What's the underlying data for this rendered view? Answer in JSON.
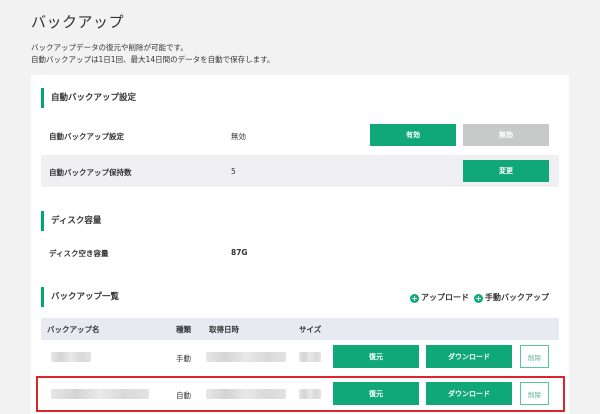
{
  "page": {
    "title": "バックアップ",
    "description_line1": "バックアップデータの復元や削除が可能です。",
    "description_line2": "自動バックアップは1日1回、最大14日間のデータを自動で保存します。"
  },
  "auto_backup": {
    "section_title": "自動バックアップ設定",
    "setting_label": "自動バックアップ設定",
    "setting_value": "無効",
    "enable_button": "有効",
    "disable_button": "無効",
    "retention_label": "自動バックアップ保持数",
    "retention_value": "5",
    "change_button": "変更"
  },
  "disk": {
    "section_title": "ディスク容量",
    "free_label": "ディスク空き容量",
    "free_value": "87G"
  },
  "backup_list": {
    "section_title": "バックアップ一覧",
    "upload_link": "アップロード",
    "manual_backup_link": "手動バックアップ",
    "columns": [
      "バックアップ名",
      "種類",
      "取得日時",
      "サイズ"
    ],
    "rows": [
      {
        "type": "手動",
        "restore": "復元",
        "download": "ダウンロード",
        "delete": "削除"
      },
      {
        "type": "自動",
        "restore": "復元",
        "download": "ダウンロード",
        "delete": "削除"
      }
    ]
  },
  "colors": {
    "accent": "#10a879",
    "highlight": "#d9252b"
  }
}
